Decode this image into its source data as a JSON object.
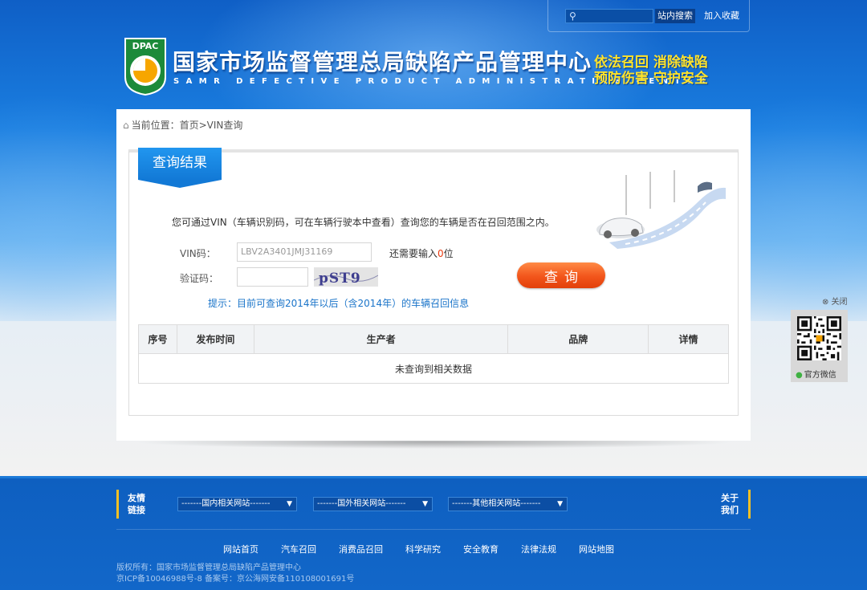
{
  "header": {
    "search_placeholder": "",
    "search_button": "站内搜索",
    "favorite": "加入收藏",
    "logo_text": "DPAC",
    "title": "国家市场监督管理总局缺陷产品管理中心",
    "subtitle": "SAMR DEFECTIVE PRODUCT ADMINISTRATIVE CENTER",
    "slogan_line1": "依法召回 消除缺陷",
    "slogan_line2": "预防伤害 守护安全",
    "colors": {
      "brand_blue": "#1279d6",
      "slogan_yellow": "#ffe32b"
    }
  },
  "breadcrumb": "当前位置：首页>VIN查询",
  "panel": {
    "tab": "查询结果",
    "intro": "您可通过VIN（车辆识别码，可在车辆行驶本中查看）查询您的车辆是否在召回范围之内。",
    "vin_label": "VIN码：",
    "vin_value": "LBV2A3401JMJ31169",
    "remain_prefix": "还需要输入",
    "remain_count": "0",
    "remain_suffix": "位",
    "captcha_label": "验证码：",
    "captcha_text": "pST9",
    "query_button": "查询",
    "hint": "提示：目前可查询2014年以后（含2014年）的车辆召回信息",
    "table": {
      "headers": [
        "序号",
        "发布时间",
        "生产者",
        "品牌",
        "详情"
      ],
      "empty": "未查询到相关数据"
    },
    "colors": {
      "query_orange": "#f2551b",
      "hint_blue": "#1a74c9",
      "count_red": "#e8380d"
    }
  },
  "qr": {
    "close": "⊗ 关闭",
    "label": "官方微信"
  },
  "footer": {
    "friend_line1": "友情",
    "friend_line2": "链接",
    "selects": [
      "-------国内相关网站-------",
      "-------国外相关网站-------",
      "-------其他相关网站-------"
    ],
    "about_line1": "关于",
    "about_line2": "我们",
    "nav": [
      "网站首页",
      "汽车召回",
      "消费品召回",
      "科学研究",
      "安全教育",
      "法律法规",
      "网站地图"
    ],
    "copyright": "版权所有：国家市场监督管理总局缺陷产品管理中心",
    "icp": "京ICP备10046988号-8 备案号：京公海网安备110108001691号"
  }
}
